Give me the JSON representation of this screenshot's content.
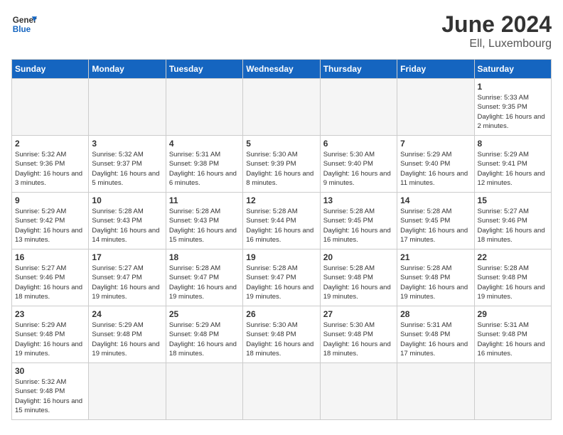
{
  "header": {
    "logo_general": "General",
    "logo_blue": "Blue",
    "month_year": "June 2024",
    "location": "Ell, Luxembourg"
  },
  "weekdays": [
    "Sunday",
    "Monday",
    "Tuesday",
    "Wednesday",
    "Thursday",
    "Friday",
    "Saturday"
  ],
  "weeks": [
    [
      {
        "day": "",
        "empty": true
      },
      {
        "day": "",
        "empty": true
      },
      {
        "day": "",
        "empty": true
      },
      {
        "day": "",
        "empty": true
      },
      {
        "day": "",
        "empty": true
      },
      {
        "day": "",
        "empty": true
      },
      {
        "day": "1",
        "sunrise": "5:33 AM",
        "sunset": "9:35 PM",
        "daylight": "16 hours and 2 minutes."
      }
    ],
    [
      {
        "day": "2",
        "sunrise": "5:32 AM",
        "sunset": "9:36 PM",
        "daylight": "16 hours and 3 minutes."
      },
      {
        "day": "3",
        "sunrise": "5:32 AM",
        "sunset": "9:37 PM",
        "daylight": "16 hours and 5 minutes."
      },
      {
        "day": "4",
        "sunrise": "5:31 AM",
        "sunset": "9:38 PM",
        "daylight": "16 hours and 6 minutes."
      },
      {
        "day": "5",
        "sunrise": "5:30 AM",
        "sunset": "9:39 PM",
        "daylight": "16 hours and 8 minutes."
      },
      {
        "day": "6",
        "sunrise": "5:30 AM",
        "sunset": "9:40 PM",
        "daylight": "16 hours and 9 minutes."
      },
      {
        "day": "7",
        "sunrise": "5:29 AM",
        "sunset": "9:40 PM",
        "daylight": "16 hours and 11 minutes."
      },
      {
        "day": "8",
        "sunrise": "5:29 AM",
        "sunset": "9:41 PM",
        "daylight": "16 hours and 12 minutes."
      }
    ],
    [
      {
        "day": "9",
        "sunrise": "5:29 AM",
        "sunset": "9:42 PM",
        "daylight": "16 hours and 13 minutes."
      },
      {
        "day": "10",
        "sunrise": "5:28 AM",
        "sunset": "9:43 PM",
        "daylight": "16 hours and 14 minutes."
      },
      {
        "day": "11",
        "sunrise": "5:28 AM",
        "sunset": "9:43 PM",
        "daylight": "16 hours and 15 minutes."
      },
      {
        "day": "12",
        "sunrise": "5:28 AM",
        "sunset": "9:44 PM",
        "daylight": "16 hours and 16 minutes."
      },
      {
        "day": "13",
        "sunrise": "5:28 AM",
        "sunset": "9:45 PM",
        "daylight": "16 hours and 16 minutes."
      },
      {
        "day": "14",
        "sunrise": "5:28 AM",
        "sunset": "9:45 PM",
        "daylight": "16 hours and 17 minutes."
      },
      {
        "day": "15",
        "sunrise": "5:27 AM",
        "sunset": "9:46 PM",
        "daylight": "16 hours and 18 minutes."
      }
    ],
    [
      {
        "day": "16",
        "sunrise": "5:27 AM",
        "sunset": "9:46 PM",
        "daylight": "16 hours and 18 minutes."
      },
      {
        "day": "17",
        "sunrise": "5:27 AM",
        "sunset": "9:47 PM",
        "daylight": "16 hours and 19 minutes."
      },
      {
        "day": "18",
        "sunrise": "5:28 AM",
        "sunset": "9:47 PM",
        "daylight": "16 hours and 19 minutes."
      },
      {
        "day": "19",
        "sunrise": "5:28 AM",
        "sunset": "9:47 PM",
        "daylight": "16 hours and 19 minutes."
      },
      {
        "day": "20",
        "sunrise": "5:28 AM",
        "sunset": "9:48 PM",
        "daylight": "16 hours and 19 minutes."
      },
      {
        "day": "21",
        "sunrise": "5:28 AM",
        "sunset": "9:48 PM",
        "daylight": "16 hours and 19 minutes."
      },
      {
        "day": "22",
        "sunrise": "5:28 AM",
        "sunset": "9:48 PM",
        "daylight": "16 hours and 19 minutes."
      }
    ],
    [
      {
        "day": "23",
        "sunrise": "5:29 AM",
        "sunset": "9:48 PM",
        "daylight": "16 hours and 19 minutes."
      },
      {
        "day": "24",
        "sunrise": "5:29 AM",
        "sunset": "9:48 PM",
        "daylight": "16 hours and 19 minutes."
      },
      {
        "day": "25",
        "sunrise": "5:29 AM",
        "sunset": "9:48 PM",
        "daylight": "16 hours and 18 minutes."
      },
      {
        "day": "26",
        "sunrise": "5:30 AM",
        "sunset": "9:48 PM",
        "daylight": "16 hours and 18 minutes."
      },
      {
        "day": "27",
        "sunrise": "5:30 AM",
        "sunset": "9:48 PM",
        "daylight": "16 hours and 18 minutes."
      },
      {
        "day": "28",
        "sunrise": "5:31 AM",
        "sunset": "9:48 PM",
        "daylight": "16 hours and 17 minutes."
      },
      {
        "day": "29",
        "sunrise": "5:31 AM",
        "sunset": "9:48 PM",
        "daylight": "16 hours and 16 minutes."
      }
    ],
    [
      {
        "day": "30",
        "sunrise": "5:32 AM",
        "sunset": "9:48 PM",
        "daylight": "16 hours and 15 minutes."
      },
      {
        "day": "",
        "empty": true
      },
      {
        "day": "",
        "empty": true
      },
      {
        "day": "",
        "empty": true
      },
      {
        "day": "",
        "empty": true
      },
      {
        "day": "",
        "empty": true
      },
      {
        "day": "",
        "empty": true
      }
    ]
  ]
}
